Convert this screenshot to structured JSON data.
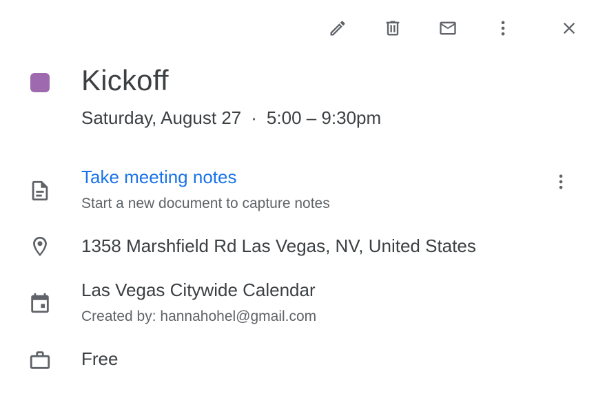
{
  "toolbar": {
    "edit_icon": "pencil-icon",
    "delete_icon": "trash-icon",
    "email_icon": "mail-icon",
    "more_icon": "more-vert-icon",
    "close_icon": "close-icon"
  },
  "event": {
    "color": "#9e69af",
    "title": "Kickoff",
    "date": "Saturday, August 27",
    "separator": "·",
    "time": "5:00 – 9:30pm"
  },
  "notes": {
    "icon": "document-icon",
    "link": "Take meeting notes",
    "subtitle": "Start a new document to capture notes",
    "more_icon": "more-vert-icon"
  },
  "location": {
    "icon": "location-pin-icon",
    "address": "1358 Marshfield Rd Las Vegas, NV, United States"
  },
  "calendar": {
    "icon": "calendar-icon",
    "name": "Las Vegas Citywide Calendar",
    "creator": "Created by: hannahohel@gmail.com"
  },
  "availability": {
    "icon": "briefcase-icon",
    "status": "Free"
  },
  "colors": {
    "text": "#3c4043",
    "secondary_text": "#5f6368",
    "link": "#1a73e8"
  }
}
